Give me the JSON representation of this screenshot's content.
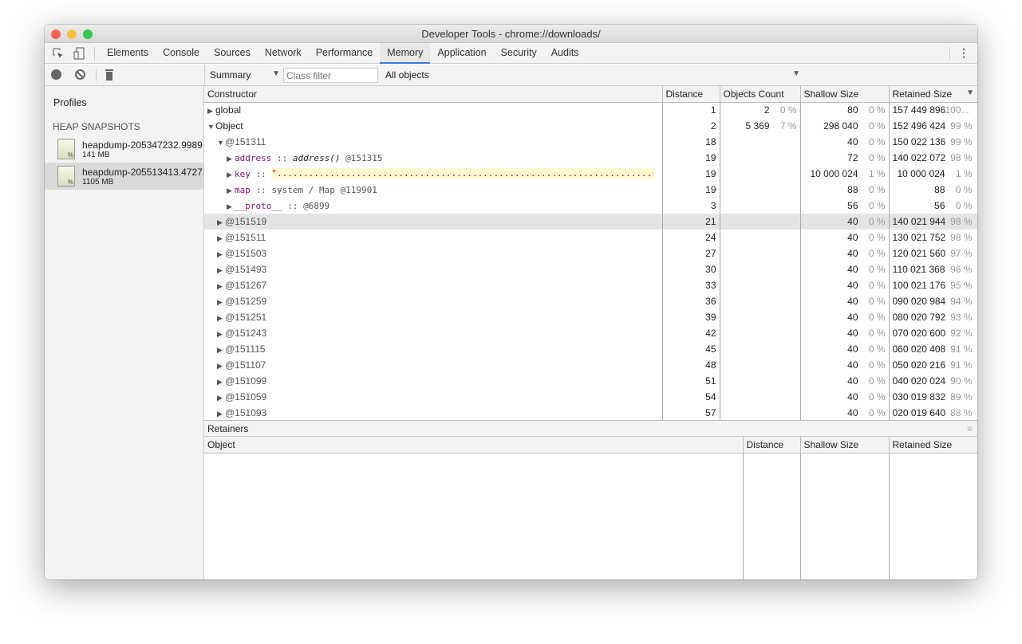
{
  "window": {
    "title": "Developer Tools - chrome://downloads/"
  },
  "tabs": [
    "Elements",
    "Console",
    "Sources",
    "Network",
    "Performance",
    "Memory",
    "Application",
    "Security",
    "Audits"
  ],
  "selected_tab": "Memory",
  "toolbar": {
    "view": "Summary",
    "class_filter_placeholder": "Class filter",
    "scope": "All objects"
  },
  "sidebar": {
    "title": "Profiles",
    "section": "HEAP SNAPSHOTS",
    "snapshots": [
      {
        "name": "heapdump-205347232.9989",
        "size": "141 MB"
      },
      {
        "name": "heapdump-205513413.4727",
        "size": "1105 MB",
        "selected": true
      }
    ]
  },
  "columns": [
    "Constructor",
    "Distance",
    "Objects Count",
    "Shallow Size",
    "Retained Size"
  ],
  "rows": [
    {
      "level": 0,
      "arrow": "▶",
      "name": "global",
      "distance": "1",
      "count": "2",
      "count_pct": "0 %",
      "shallow": "80",
      "shallow_pct": "0 %",
      "retained": "157 449 896",
      "retained_pct": "100..."
    },
    {
      "level": 0,
      "arrow": "▼",
      "name": "Object",
      "distance": "2",
      "count": "5 369",
      "count_pct": "7 %",
      "shallow": "298 040",
      "shallow_pct": "0 %",
      "retained": "152 496 424",
      "retained_pct": "99 %"
    },
    {
      "level": 1,
      "arrow": "▼",
      "name": "@151311",
      "distance": "18",
      "shallow": "40",
      "shallow_pct": "0 %",
      "retained": "150 022 136",
      "retained_pct": "99 %"
    },
    {
      "level": 2,
      "arrow": "▶",
      "prop": "address",
      "sep": " :: ",
      "value": "address()",
      "id": " @151315",
      "italic": true,
      "distance": "19",
      "shallow": "72",
      "shallow_pct": "0 %",
      "retained": "140 022 072",
      "retained_pct": "98 %"
    },
    {
      "level": 2,
      "arrow": "▶",
      "prop": "key",
      "sep": " :: ",
      "string": "\"................................................................................",
      "distance": "19",
      "shallow": "10 000 024",
      "shallow_pct": "1 %",
      "retained": "10 000 024",
      "retained_pct": "1 %"
    },
    {
      "level": 2,
      "arrow": "▶",
      "prop": "map",
      "sep": " :: ",
      "value": "system / Map",
      "id": " @119901",
      "plain": true,
      "distance": "19",
      "shallow": "88",
      "shallow_pct": "0 %",
      "retained": "88",
      "retained_pct": "0 %"
    },
    {
      "level": 2,
      "arrow": "▶",
      "prop": "__proto__",
      "sep": " :: ",
      "id": "@6899",
      "distance": "3",
      "shallow": "56",
      "shallow_pct": "0 %",
      "retained": "56",
      "retained_pct": "0 %"
    },
    {
      "level": 1,
      "arrow": "▶",
      "name": "@151519",
      "distance": "21",
      "shallow": "40",
      "shallow_pct": "0 %",
      "retained": "140 021 944",
      "retained_pct": "98 %",
      "highlight": true
    },
    {
      "level": 1,
      "arrow": "▶",
      "name": "@151511",
      "distance": "24",
      "shallow": "40",
      "shallow_pct": "0 %",
      "retained": "130 021 752",
      "retained_pct": "98 %"
    },
    {
      "level": 1,
      "arrow": "▶",
      "name": "@151503",
      "distance": "27",
      "shallow": "40",
      "shallow_pct": "0 %",
      "retained": "120 021 560",
      "retained_pct": "97 %"
    },
    {
      "level": 1,
      "arrow": "▶",
      "name": "@151493",
      "distance": "30",
      "shallow": "40",
      "shallow_pct": "0 %",
      "retained": "110 021 368",
      "retained_pct": "96 %"
    },
    {
      "level": 1,
      "arrow": "▶",
      "name": "@151267",
      "distance": "33",
      "shallow": "40",
      "shallow_pct": "0 %",
      "retained": "100 021 176",
      "retained_pct": "95 %"
    },
    {
      "level": 1,
      "arrow": "▶",
      "name": "@151259",
      "distance": "36",
      "shallow": "40",
      "shallow_pct": "0 %",
      "retained": "090 020 984",
      "retained_pct": "94 %"
    },
    {
      "level": 1,
      "arrow": "▶",
      "name": "@151251",
      "distance": "39",
      "shallow": "40",
      "shallow_pct": "0 %",
      "retained": "080 020 792",
      "retained_pct": "93 %"
    },
    {
      "level": 1,
      "arrow": "▶",
      "name": "@151243",
      "distance": "42",
      "shallow": "40",
      "shallow_pct": "0 %",
      "retained": "070 020 600",
      "retained_pct": "92 %"
    },
    {
      "level": 1,
      "arrow": "▶",
      "name": "@151115",
      "distance": "45",
      "shallow": "40",
      "shallow_pct": "0 %",
      "retained": "060 020 408",
      "retained_pct": "91 %"
    },
    {
      "level": 1,
      "arrow": "▶",
      "name": "@151107",
      "distance": "48",
      "shallow": "40",
      "shallow_pct": "0 %",
      "retained": "050 020 216",
      "retained_pct": "91 %"
    },
    {
      "level": 1,
      "arrow": "▶",
      "name": "@151099",
      "distance": "51",
      "shallow": "40",
      "shallow_pct": "0 %",
      "retained": "040 020 024",
      "retained_pct": "90 %"
    },
    {
      "level": 1,
      "arrow": "▶",
      "name": "@151059",
      "distance": "54",
      "shallow": "40",
      "shallow_pct": "0 %",
      "retained": "030 019 832",
      "retained_pct": "89 %"
    },
    {
      "level": 1,
      "arrow": "▶",
      "name": "@151093",
      "distance": "57",
      "shallow": "40",
      "shallow_pct": "0 %",
      "retained": "020 019 640",
      "retained_pct": "88 %"
    }
  ],
  "retainers": {
    "title": "Retainers",
    "columns": [
      "Object",
      "Distance",
      "Shallow Size",
      "Retained Size"
    ]
  },
  "colors": {
    "accent": "#3879d9",
    "property": "#881280",
    "string": "#c80000",
    "highlight": "#fffbd0"
  }
}
